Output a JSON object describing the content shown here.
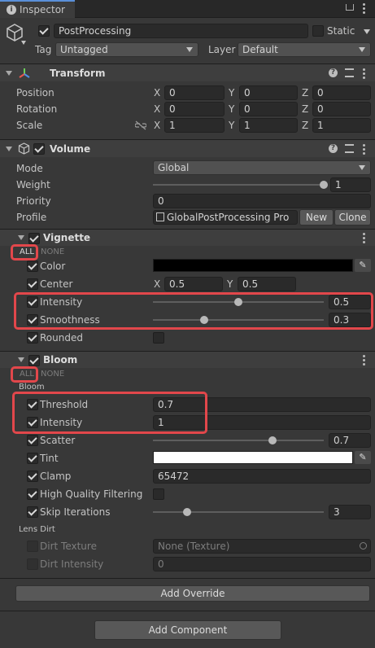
{
  "tab": {
    "title": "Inspector"
  },
  "object": {
    "name": "PostProcessing",
    "static_label": "Static",
    "tag_label": "Tag",
    "tag_value": "Untagged",
    "layer_label": "Layer",
    "layer_value": "Default"
  },
  "transform": {
    "title": "Transform",
    "rows": [
      {
        "label": "Position",
        "x": "0",
        "y": "0",
        "z": "0"
      },
      {
        "label": "Rotation",
        "x": "0",
        "y": "0",
        "z": "0"
      },
      {
        "label": "Scale",
        "x": "1",
        "y": "1",
        "z": "1"
      }
    ],
    "axis": {
      "x": "X",
      "y": "Y",
      "z": "Z"
    }
  },
  "volume": {
    "title": "Volume",
    "mode_label": "Mode",
    "mode_value": "Global",
    "weight_label": "Weight",
    "weight_value": "1",
    "weight_level": 1.0,
    "priority_label": "Priority",
    "priority_value": "0",
    "profile_label": "Profile",
    "profile_value": "GlobalPostProcessing Pro",
    "new_label": "New",
    "clone_label": "Clone"
  },
  "vignette": {
    "title": "Vignette",
    "all_label": "ALL",
    "none_label": "NONE",
    "color_label": "Color",
    "color_value": "#000000",
    "center_label": "Center",
    "center_x": "0.5",
    "center_y": "0.5",
    "intensity_label": "Intensity",
    "intensity_value": "0.5",
    "intensity_level": 0.5,
    "smoothness_label": "Smoothness",
    "smoothness_value": "0.3",
    "smoothness_level": 0.3,
    "rounded_label": "Rounded"
  },
  "bloom": {
    "title": "Bloom",
    "all_label": "ALL",
    "none_label": "NONE",
    "section_label": "Bloom",
    "threshold_label": "Threshold",
    "threshold_value": "0.7",
    "intensity_label": "Intensity",
    "intensity_value": "1",
    "scatter_label": "Scatter",
    "scatter_value": "0.7",
    "scatter_level": 0.7,
    "tint_label": "Tint",
    "tint_value": "#ffffff",
    "clamp_label": "Clamp",
    "clamp_value": "65472",
    "hq_label": "High Quality Filtering",
    "skip_label": "Skip Iterations",
    "skip_value": "3",
    "skip_level": 0.2,
    "lens_label": "Lens Dirt",
    "dirt_tex_label": "Dirt Texture",
    "dirt_tex_value": "None (Texture)",
    "dirt_int_label": "Dirt Intensity",
    "dirt_int_value": "0"
  },
  "buttons": {
    "add_override": "Add Override",
    "add_component": "Add Component"
  },
  "colors": {
    "accent_red": "#e2474b"
  }
}
